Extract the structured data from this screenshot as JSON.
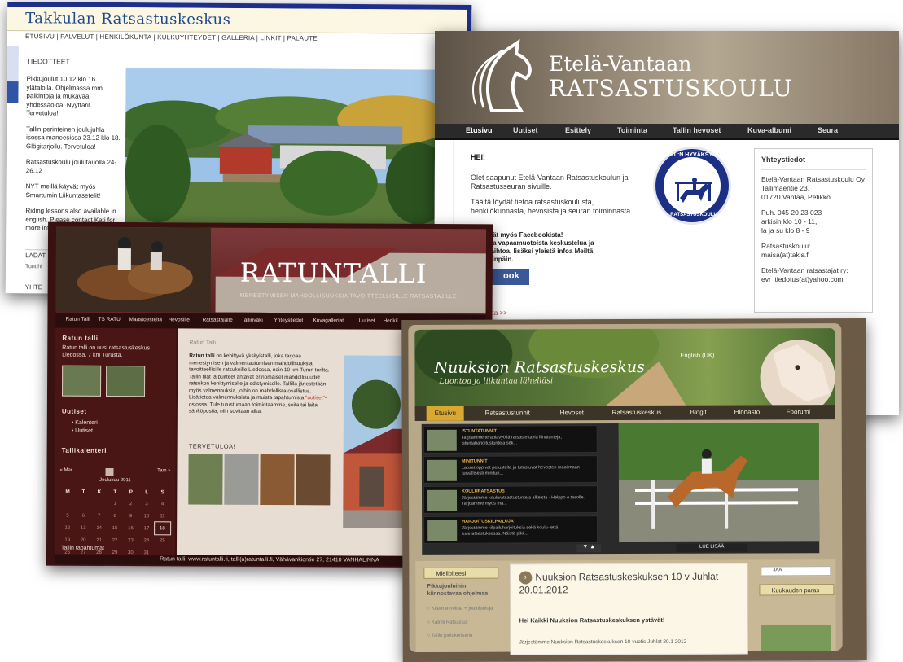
{
  "takkula": {
    "logo": "Takkulan Ratsastuskeskus",
    "nav": "ETUSIVU | PALVELUT | HENKILÖKUNTA | KULKUYHTEYDET | GALLERIA | LINKIT | PALAUTE",
    "news_title": "TIEDOTTEET",
    "news": [
      "Pikkujoulut 10.12 klo 16 ylätalolla. Ohjelmassa mm. palkintoja ja mukavaa yhdessäoloa. Nyyttärit. Tervetuloa!",
      "Tallin perinteinen joulujuhla isossa maneesissa 23.12 klo 18. Glögitarjoilu. Tervetuloa!",
      "Ratsastuskoulu joulutauolla 24-26.12",
      "NYT meillä käyvät myös Smartumin Liikuntasetelit!",
      "Riding lessons also available in english. Please contact Kati for more information."
    ],
    "footer_1": "LADAT",
    "footer_2": "Tuntihi",
    "footer_3": "YHTE"
  },
  "etela": {
    "brand_line1": "Etelä-Vantaan",
    "brand_line2": "RATSASTUSKOULU",
    "nav": [
      "Etusivu",
      "Uutiset",
      "Esittely",
      "Toiminta",
      "Tallin hevoset",
      "Kuva-albumi",
      "Seura"
    ],
    "greeting": "HEI!",
    "intro_1": "Olet saapunut Etelä-Vantaan Ratsastuskoulun ja Ratsastusseuran sivuille.",
    "intro_2": "Täältä löydät tietoa ratsastuskoulusta, henkilökunnasta, hevosista ja seuran toiminnasta.",
    "facebook_1": "idät myös Facebookista!",
    "facebook_2": "sta vapaamuotoista keskustelua ja",
    "facebook_3": "vaihtoa, lisäksi yleistä infoa Meiltä",
    "facebook_4": "isinpäin.",
    "facebook_button": "ook",
    "more_link": "etta >>",
    "seal_top": "SRL:N HYVÄKSYMÄ",
    "seal_bottom": "RATSASTUSKOULU",
    "contact_title": "Yhteystiedot",
    "contact_company": "Etelä-Vantaan Ratsastuskoulu Oy",
    "contact_street": "Tallimäentie 23,",
    "contact_city": "01720 Vantaa, Petikko",
    "contact_phone": "Puh. 045 20 23 023",
    "contact_hours_1": "arkisin klo 10 - 11,",
    "contact_hours_2": "la ja su klo 8 - 9",
    "school_label": "Ratsastuskoulu:",
    "school_mail": "maisa(at)takis.fi",
    "club_label": "Etelä-Vantaan ratsastajat ry:",
    "club_mail": "evr_tiedotus(at)yahoo.com"
  },
  "ratun": {
    "logo": "RATUNTALLI",
    "slogan": "MENESTYMISEN MAHDOLLISUUKSIA TAVOITTEELLISILLE RATSASTAJILLE",
    "nav": [
      "Ratun Talli",
      "TS RATU",
      "Maastoesteitä",
      "Hevosille",
      "Ratsastajalle",
      "Tallinväki",
      "Yhteystiedot",
      "Kuvagalleriat",
      "Uutiset",
      "Henkil"
    ],
    "side_title_1": "Ratun talli",
    "side_text_1": "Ratun talli on uusi ratsastuskeskus Liedossa, 7 km Turusta.",
    "side_title_2": "Uutiset",
    "side_links": [
      "Kalenteri",
      "Uutiset"
    ],
    "side_title_3": "Tallikalenteri",
    "cal_prev": "« Mar",
    "cal_next": "Tam »",
    "cal_month": "Joulukuu 2011",
    "cal_days": [
      "M",
      "T",
      "K",
      "T",
      "P",
      "L",
      "S"
    ],
    "cal_rows": [
      [
        "",
        "",
        "",
        "1",
        "2",
        "3",
        "4"
      ],
      [
        "5",
        "6",
        "7",
        "8",
        "9",
        "10",
        "11"
      ],
      [
        "12",
        "13",
        "14",
        "15",
        "16",
        "17",
        "18"
      ],
      [
        "19",
        "20",
        "21",
        "22",
        "23",
        "24",
        "25"
      ],
      [
        "26",
        "27",
        "28",
        "29",
        "30",
        "31",
        ""
      ]
    ],
    "cal_today": "18",
    "side_footer": "Tallin tapahtumat",
    "main_title": "Ratun Talli",
    "main_lead": "Ratun talli",
    "main_text": " on kehittyvä yksityistalli, joka tarjoaa menestymisen ja valmentautumisen mahdollisuuksia tavoitteellisille ratsukoille Liedossa, noin 10 km Turun torilta. Tallin tilat ja puitteet antavat erinomaiset mahdollisuudet ratsukon kehittymiselle ja edistymiselle. Tallilla järjestetään myös valmennuksia, joihin on mahdollista osallistua. Lisätietoa valmennuksista ja muista tapahtumista ",
    "main_link": "\"uutiset\"",
    "main_tail": "-osiossa. Tule tutustumaan toimintaamme, soita tai laita sähköpostia, niin sovitaan aika.",
    "welcome": "TERVETULOA!",
    "footer": "Ratun talli: www.ratuntalli.fi, talli(a)ratuntalli.fi, Vähävankiontie 27, 21410 VANHALINNA"
  },
  "nuuksio": {
    "brand": "Nuuksion Ratsastuskeskus",
    "tagline": "Luontoa ja liikuntaa lähelläsi",
    "lang": "English (UK)",
    "nav": [
      "Etusivu",
      "Ratsastustunnit",
      "Hevoset",
      "Ratsastuskeskus",
      "Blogit",
      "Hinnasto",
      "Foorumi"
    ],
    "slides": [
      {
        "title": "ISTUNTATUNNIT",
        "desc": "Tarjoamme terapiavyöliä ratsastettavia liinatunteja, istuntaharjoitustunteja sek..."
      },
      {
        "title": "MINITUNNIT",
        "desc": "Lapset oppivat perusteita ja tutustuvat hevosten maailmaan turvallisesti minitun..."
      },
      {
        "title": "KOULURATSASTUS",
        "desc": "Järjestämme kouluratsastustunteja alkeista - Helppo A tasolle. Tarjoamme myös ma..."
      },
      {
        "title": "HARJOITUSKILPAILUJA",
        "desc": "Järjestämme kilpailuharjoituksia sekä koulu- että esteratsastuksessa. Näistä pikk..."
      }
    ],
    "read_more": "LUE LISÄÄ",
    "opinion_button": "Mielipiteesi",
    "side_heading": "Pikkujouluihin kiinnostavaa ohjelmaa",
    "side_options": [
      "Kiteerannoltaa + joululauluja",
      "Katrilli Ratsastus",
      "Tallin joulukoristelu"
    ],
    "share": "JAA",
    "month_best": "Kuukauden paras",
    "event_title": "Nuuksion Ratsastuskeskuksen 10 v Juhlat 20.01.2012",
    "event_greeting": "Hei Kaikki Nuuksion Ratsastuskeskuksen ystävät!",
    "event_text": "Järjestämme Nuuksion Ratsastuskeskuksen 10-vuotis Juhlat 20.1 2012"
  }
}
